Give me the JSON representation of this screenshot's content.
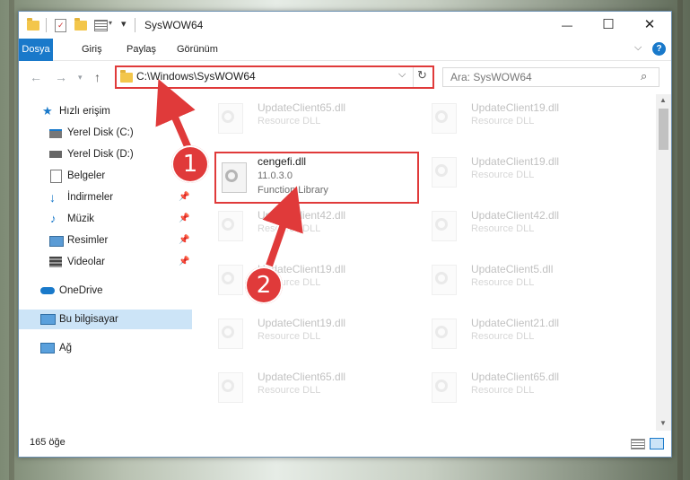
{
  "window": {
    "title": "SysWOW64",
    "controls": {
      "minimize": "—",
      "maximize": "☐",
      "close": "✕"
    }
  },
  "ribbon": {
    "tabs": [
      "Dosya",
      "Giriş",
      "Paylaş",
      "Görünüm"
    ],
    "help": "?"
  },
  "address": {
    "path": "C:\\Windows\\SysWOW64",
    "search_placeholder": "Ara: SysWOW64"
  },
  "sidebar": {
    "quick_access": "Hızlı erişim",
    "items": [
      {
        "label": "Yerel Disk (C:)",
        "icon": "drive-icon",
        "pinned": false
      },
      {
        "label": "Yerel Disk (D:)",
        "icon": "drive-icon",
        "pinned": false
      },
      {
        "label": "Belgeler",
        "icon": "documents-icon",
        "pinned": true
      },
      {
        "label": "İndirmeler",
        "icon": "downloads-icon",
        "pinned": true
      },
      {
        "label": "Müzik",
        "icon": "music-icon",
        "pinned": true
      },
      {
        "label": "Resimler",
        "icon": "pictures-icon",
        "pinned": true
      },
      {
        "label": "Videolar",
        "icon": "videos-icon",
        "pinned": true
      }
    ],
    "onedrive": "OneDrive",
    "this_pc": "Bu bilgisayar",
    "network": "Ağ"
  },
  "files": [
    {
      "name": "UpdateClient65.dll",
      "line2": "Resource DLL",
      "line3": "",
      "faded": true
    },
    {
      "name": "UpdateClient19.dll",
      "line2": "Resource DLL",
      "line3": "",
      "faded": true
    },
    {
      "name": "cengefi.dll",
      "line2": "11.0.3.0",
      "line3": "Function Library",
      "faded": false
    },
    {
      "name": "UpdateClient19.dll",
      "line2": "Resource DLL",
      "line3": "",
      "faded": true
    },
    {
      "name": "UpdateClient42.dll",
      "line2": "Resource DLL",
      "line3": "",
      "faded": true
    },
    {
      "name": "UpdateClient42.dll",
      "line2": "Resource DLL",
      "line3": "",
      "faded": true
    },
    {
      "name": "UpdateClient19.dll",
      "line2": "Resource DLL",
      "line3": "",
      "faded": true
    },
    {
      "name": "UpdateClient5.dll",
      "line2": "Resource DLL",
      "line3": "",
      "faded": true
    },
    {
      "name": "UpdateClient19.dll",
      "line2": "Resource DLL",
      "line3": "",
      "faded": true
    },
    {
      "name": "UpdateClient21.dll",
      "line2": "Resource DLL",
      "line3": "",
      "faded": true
    },
    {
      "name": "UpdateClient65.dll",
      "line2": "Resource DLL",
      "line3": "",
      "faded": true
    },
    {
      "name": "UpdateClient65.dll",
      "line2": "Resource DLL",
      "line3": "",
      "faded": true
    }
  ],
  "status": {
    "item_count": "165 öğe"
  },
  "annotations": {
    "step1": "1",
    "step2": "2",
    "color": "#e03a3a"
  }
}
